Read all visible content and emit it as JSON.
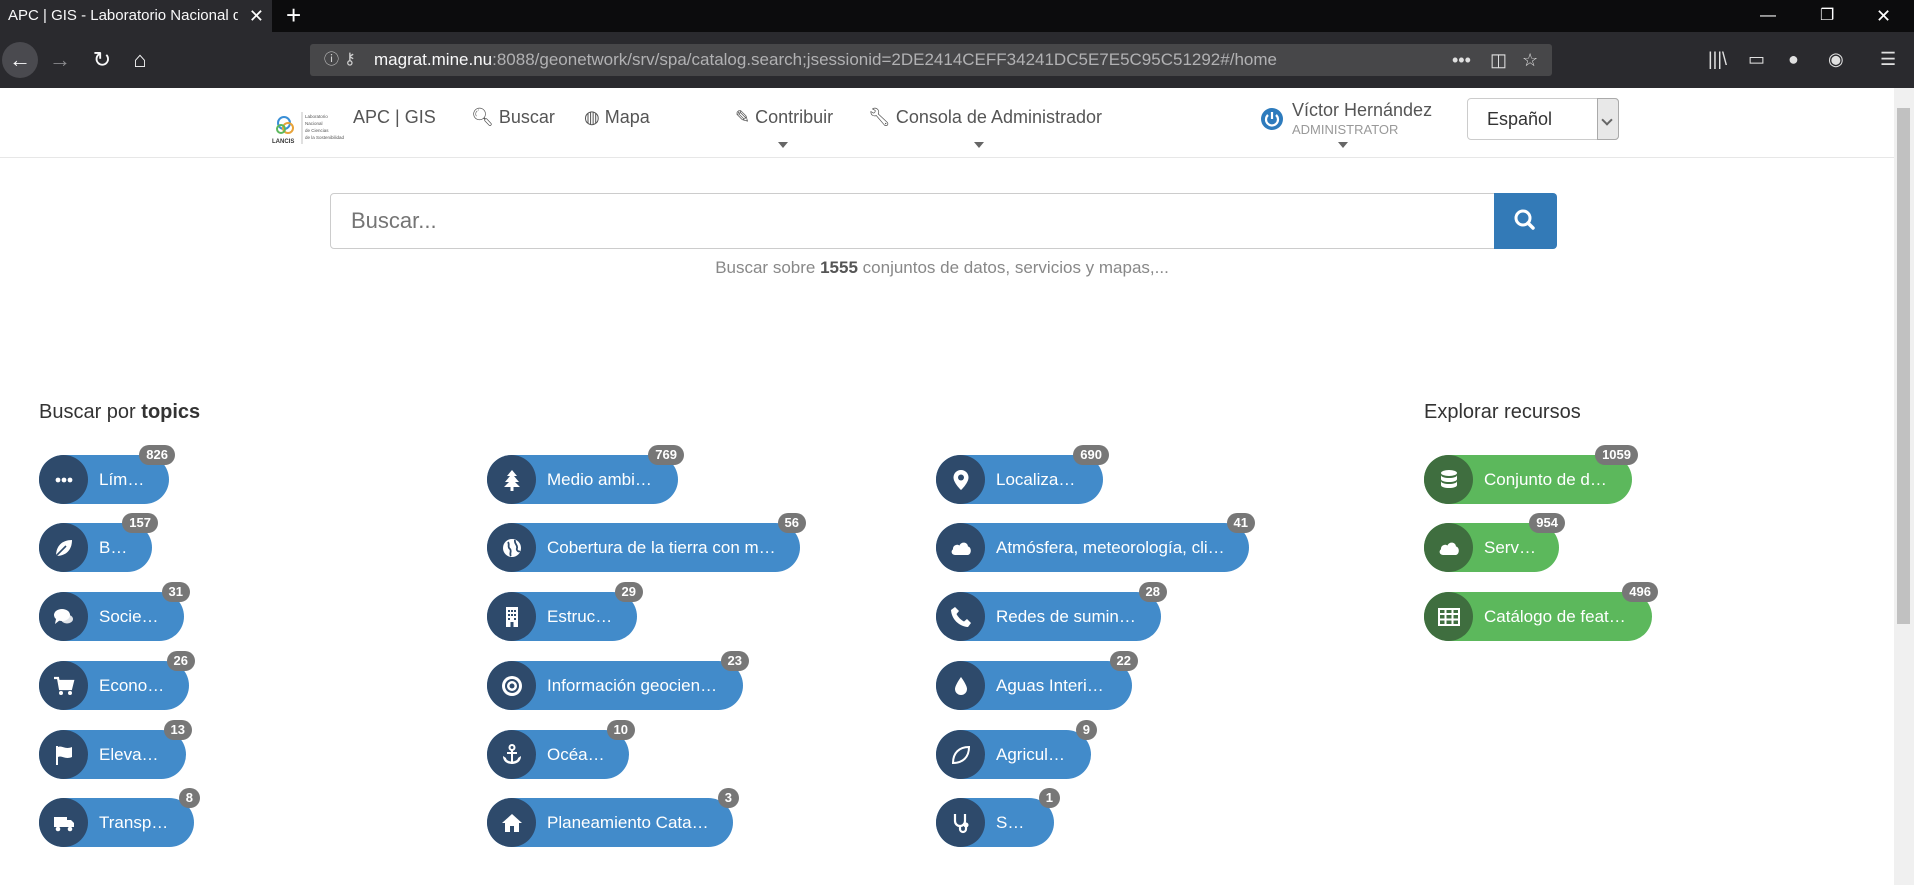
{
  "browser": {
    "tab_title": "APC | GIS - Laboratorio Nacional de",
    "url_host": "magrat.mine.nu",
    "url_rest": ":8088/geonetwork/srv/spa/catalog.search;jsessionid=2DE2414CEFF34241DC5E7E5C95C51292#/home"
  },
  "header": {
    "logo_text": "LANCIS",
    "logo_sub": [
      "Laboratorio",
      "Nacional",
      "de Ciencias",
      "de la Sostenibilidad"
    ],
    "brand": "APC | GIS",
    "search": "Buscar",
    "map": "Mapa",
    "contribute": "Contribuir",
    "admin": "Consola de Administrador",
    "user_name": "Víctor Hernández",
    "user_role": "ADMINISTRATOR",
    "language": "Español"
  },
  "search": {
    "placeholder": "Buscar...",
    "hint_prefix": "Buscar sobre",
    "hint_count": "1555",
    "hint_suffix": "conjuntos de datos, servicios y mapas,..."
  },
  "topics": {
    "title_prefix": "Buscar por",
    "title_bold": "topics",
    "items": [
      {
        "label": "Límites",
        "count": "826",
        "icon": "dots-icon"
      },
      {
        "label": "Biota",
        "count": "157",
        "icon": "leaf-icon"
      },
      {
        "label": "Sociedad",
        "count": "31",
        "icon": "comments-icon"
      },
      {
        "label": "Economía",
        "count": "26",
        "icon": "cart-icon"
      },
      {
        "label": "Elevación",
        "count": "13",
        "icon": "flag-icon"
      },
      {
        "label": "Transporte",
        "count": "8",
        "icon": "truck-icon"
      },
      {
        "label": "Medio ambiente",
        "count": "769",
        "icon": "tree-icon"
      },
      {
        "label": "Cobertura de la tierra con ma…",
        "count": "56",
        "icon": "globe-icon"
      },
      {
        "label": "Estructura",
        "count": "29",
        "icon": "building-icon"
      },
      {
        "label": "Información geocientífica",
        "count": "23",
        "icon": "target-icon"
      },
      {
        "label": "Océanos",
        "count": "10",
        "icon": "anchor-icon"
      },
      {
        "label": "Planeamiento Catastral",
        "count": "3",
        "icon": "home-icon"
      },
      {
        "label": "Localización",
        "count": "690",
        "icon": "map-marker-icon"
      },
      {
        "label": "Atmósfera, meteorología, clim…",
        "count": "41",
        "icon": "cloud-icon"
      },
      {
        "label": "Redes de suministro",
        "count": "28",
        "icon": "phone-icon"
      },
      {
        "label": "Aguas Interiores",
        "count": "22",
        "icon": "drop-icon"
      },
      {
        "label": "Agricultura",
        "count": "9",
        "icon": "leaf-outline-icon"
      },
      {
        "label": "Salud",
        "count": "1",
        "icon": "stethoscope-icon"
      }
    ]
  },
  "resources": {
    "title": "Explorar recursos",
    "items": [
      {
        "label": "Conjunto de datos",
        "count": "1059",
        "icon": "database-icon"
      },
      {
        "label": "Servicio",
        "count": "954",
        "icon": "cloud-icon"
      },
      {
        "label": "Catálogo de features",
        "count": "496",
        "icon": "table-icon"
      }
    ]
  },
  "colors": {
    "chip_blue": "#428bca",
    "chip_green": "#5cb85c",
    "primary": "#337ab7"
  }
}
